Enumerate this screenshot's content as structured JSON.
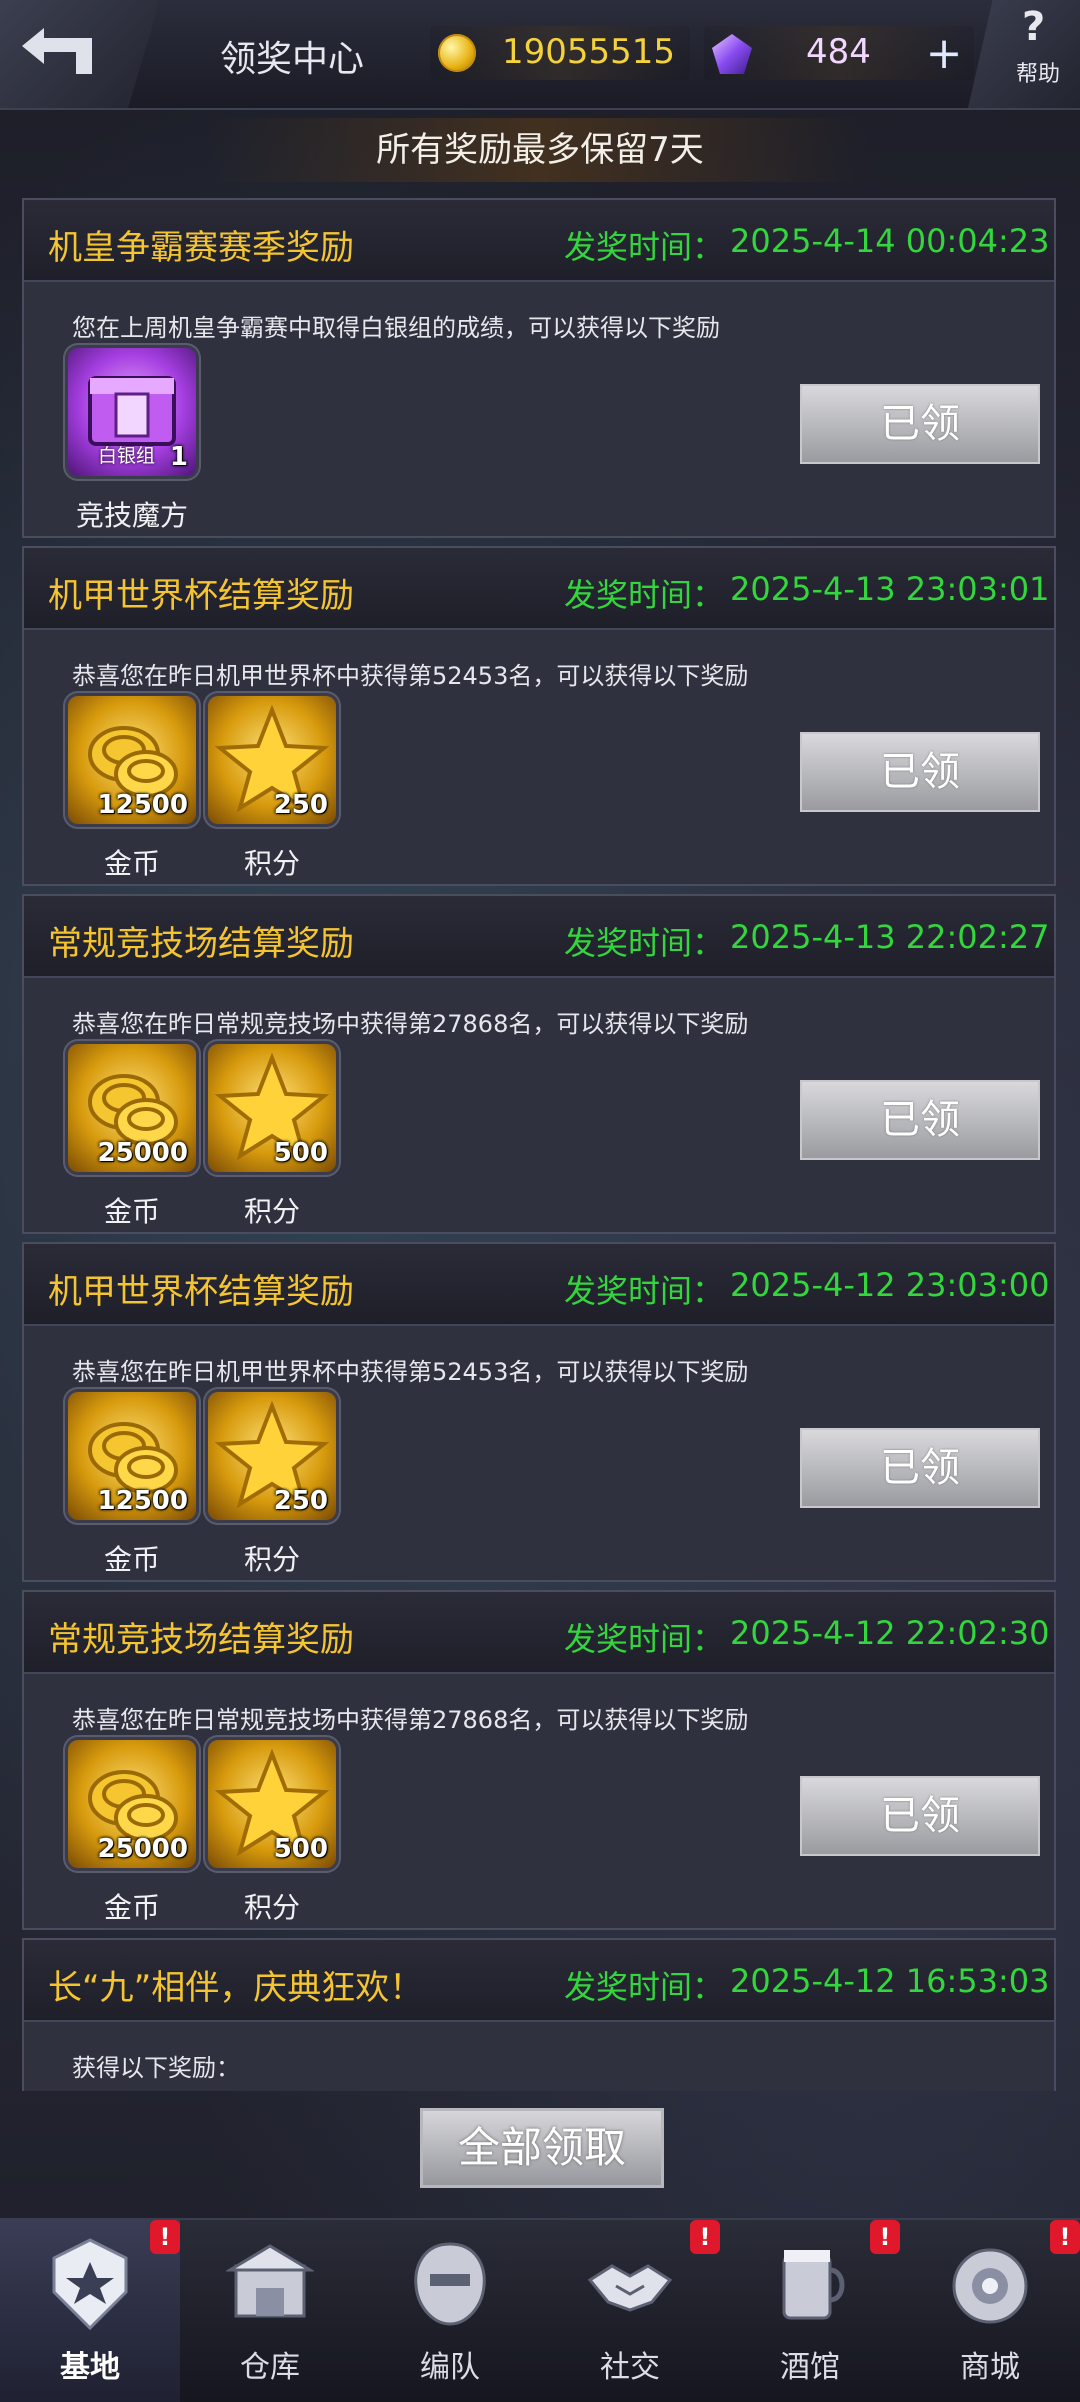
{
  "header": {
    "title": "领奖中心",
    "coins": "19055515",
    "gems": "484",
    "plus": "+",
    "help_label": "帮助",
    "help_icon_glyph": "?"
  },
  "banner": "所有奖励最多保留7天",
  "time_label": "发奖时间：",
  "cards": [
    {
      "title": "机皇争霸赛赛季奖励",
      "time": "2025-4-14 00:04:23",
      "desc": "您在上周机皇争霸赛中取得白银组的成绩，可以获得以下奖励",
      "items": [
        {
          "type": "box",
          "name": "竞技魔方",
          "qty": "1",
          "tag": "白银组"
        }
      ],
      "button": "已领"
    },
    {
      "title": "机甲世界杯结算奖励",
      "time": "2025-4-13 23:03:01",
      "desc": "恭喜您在昨日机甲世界杯中获得第52453名，可以获得以下奖励",
      "items": [
        {
          "type": "coin",
          "name": "金币",
          "qty": "12500"
        },
        {
          "type": "star",
          "name": "积分",
          "qty": "250"
        }
      ],
      "button": "已领"
    },
    {
      "title": "常规竞技场结算奖励",
      "time": "2025-4-13 22:02:27",
      "desc": "恭喜您在昨日常规竞技场中获得第27868名，可以获得以下奖励",
      "items": [
        {
          "type": "coin",
          "name": "金币",
          "qty": "25000"
        },
        {
          "type": "star",
          "name": "积分",
          "qty": "500"
        }
      ],
      "button": "已领"
    },
    {
      "title": "机甲世界杯结算奖励",
      "time": "2025-4-12 23:03:00",
      "desc": "恭喜您在昨日机甲世界杯中获得第52453名，可以获得以下奖励",
      "items": [
        {
          "type": "coin",
          "name": "金币",
          "qty": "12500"
        },
        {
          "type": "star",
          "name": "积分",
          "qty": "250"
        }
      ],
      "button": "已领"
    },
    {
      "title": "常规竞技场结算奖励",
      "time": "2025-4-12 22:02:30",
      "desc": "恭喜您在昨日常规竞技场中获得第27868名，可以获得以下奖励",
      "items": [
        {
          "type": "coin",
          "name": "金币",
          "qty": "25000"
        },
        {
          "type": "star",
          "name": "积分",
          "qty": "500"
        }
      ],
      "button": "已领"
    },
    {
      "title": "长“九”相伴，庆典狂欢！",
      "time": "2025-4-12 16:53:03",
      "desc": "获得以下奖励：",
      "items": [],
      "button": ""
    }
  ],
  "claim_all": "全部领取",
  "nav": [
    {
      "label": "基地",
      "icon": "base-icon",
      "badge": "!",
      "active": true
    },
    {
      "label": "仓库",
      "icon": "warehouse-icon",
      "badge": "",
      "active": false
    },
    {
      "label": "编队",
      "icon": "formation-icon",
      "badge": "",
      "active": false
    },
    {
      "label": "社交",
      "icon": "handshake-icon",
      "badge": "!",
      "active": false
    },
    {
      "label": "酒馆",
      "icon": "tavern-icon",
      "badge": "!",
      "active": false
    },
    {
      "label": "商城",
      "icon": "shop-icon",
      "badge": "!",
      "active": false
    }
  ],
  "colors": {
    "title_gold": "#f4c431",
    "time_green": "#33d63d",
    "badge_red": "#e0182b"
  }
}
